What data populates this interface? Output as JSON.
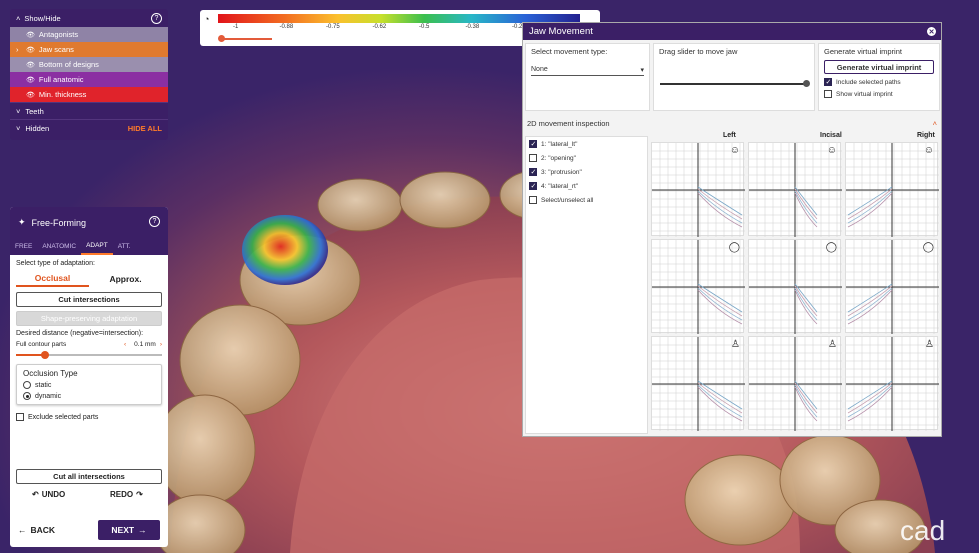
{
  "show_hide": {
    "title": "Show/Hide",
    "items": [
      {
        "label": "Antagonists",
        "bg": "#8f83a6",
        "arrow": ""
      },
      {
        "label": "Jaw scans",
        "bg": "#e07a2f",
        "arrow": "›"
      },
      {
        "label": "Bottom of designs",
        "bg": "#9a8fae",
        "arrow": ""
      },
      {
        "label": "Full anatomic",
        "bg": "#8b2fa2",
        "arrow": ""
      },
      {
        "label": "Min. thickness",
        "bg": "#e0232b",
        "arrow": ""
      }
    ],
    "teeth": "Teeth",
    "hidden": "Hidden",
    "hide_all": "HIDE ALL"
  },
  "colorbar": {
    "ticks": [
      "-1",
      "-0.88",
      "-0.75",
      "-0.62",
      "-0.5",
      "-0.38",
      "-0.25"
    ]
  },
  "free_forming": {
    "title": "Free-Forming",
    "tabs": [
      "FREE",
      "ANATOMIC",
      "ADAPT",
      "ATT."
    ],
    "active_tab": "ADAPT",
    "select_label": "Select type of adaptation:",
    "opt_occlusal": "Occlusal",
    "opt_approx": "Approx.",
    "cut_intersections": "Cut intersections",
    "shape_preserving": "Shape-preserving adaptation",
    "desired_distance": "Desired distance (negative=intersection):",
    "full_contour": "Full contour parts",
    "distance_value": "0.1 mm",
    "slider_level": 0.2,
    "occlusion_type": "Occlusion Type",
    "static": "static",
    "dynamic": "dynamic",
    "exclude": "Exclude selected parts",
    "cut_all": "Cut all intersections",
    "undo": "UNDO",
    "redo": "REDO",
    "back": "BACK",
    "next": "NEXT"
  },
  "jaw_movement": {
    "title": "Jaw Movement",
    "select_type_label": "Select movement type:",
    "select_value": "None",
    "drag_label": "Drag slider to move jaw",
    "drag_level": 1.0,
    "gen_label": "Generate virtual imprint",
    "gen_button": "Generate virtual imprint",
    "include_paths": "Include selected paths",
    "show_imprint": "Show virtual imprint",
    "inspection": "2D movement inspection",
    "paths": [
      {
        "label": "1: \"lateral_lt\"",
        "checked": true
      },
      {
        "label": "2: \"opening\"",
        "checked": false
      },
      {
        "label": "3: \"protrusion\"",
        "checked": true
      },
      {
        "label": "4: \"lateral_rt\"",
        "checked": true
      },
      {
        "label": "Select/unselect all",
        "checked": false
      }
    ],
    "columns": [
      "Left",
      "Incisal",
      "Right"
    ]
  },
  "brand": "cad"
}
